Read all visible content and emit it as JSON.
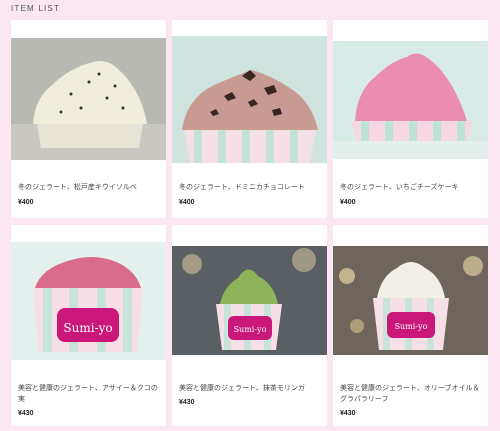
{
  "section": {
    "title": "ITEM LIST"
  },
  "items": [
    {
      "name": "冬のジェラート、松戸産キウイソルベ",
      "price": "¥400",
      "image": "vanilla-chip gelato cup"
    },
    {
      "name": "冬のジェラート、ドミニカチョコレート",
      "price": "¥400",
      "image": "chocolate gelato cup"
    },
    {
      "name": "冬のジェラート、いちごチーズケーキ",
      "price": "¥400",
      "image": "strawberry cheesecake gelato cup"
    },
    {
      "name": "美容と健康のジェラート、アサイー＆クコの実",
      "price": "¥430",
      "image": "acai gelato cup",
      "cup_brand": "Sumi-yo"
    },
    {
      "name": "美容と健康のジェラート、抹茶モリンガ",
      "price": "¥430",
      "image": "matcha moringa gelato cup",
      "cup_brand": "Sumi-yo"
    },
    {
      "name": "美容と健康のジェラート、オリーブオイル＆グラパラリーフ",
      "price": "¥430",
      "image": "olive oil gelato cup",
      "cup_brand": "Sumi-yo"
    }
  ]
}
